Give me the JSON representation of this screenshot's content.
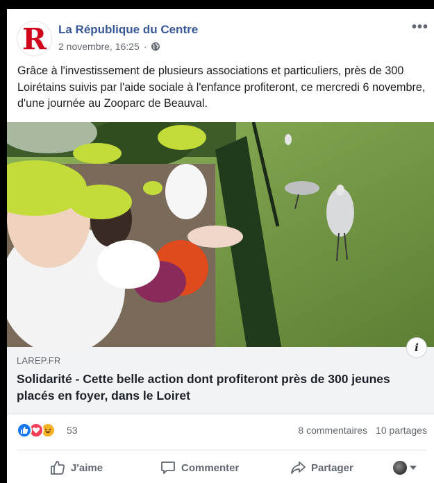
{
  "post": {
    "page_name": "La République du Centre",
    "avatar_letter": "R",
    "date": "2 novembre, 16:25",
    "separator": "·",
    "more": "•••",
    "text": "Grâce à l'investissement de plusieurs associations et particuliers, près de 300 Loirétains suivis par l'aide sociale à l'enfance profiteront, ce mercredi 6 novembre, d'une journée au Zooparc de Beauval."
  },
  "link": {
    "domain": "LAREP.FR",
    "headline": "Solidarité - Cette belle action dont profiteront près de 300 jeunes placés en foyer, dans le Loiret",
    "info": "i"
  },
  "stats": {
    "reaction_count": "53",
    "comments": "8 commentaires",
    "shares": "10 partages"
  },
  "actions": {
    "like": "J'aime",
    "comment": "Commenter",
    "share": "Partager"
  },
  "colors": {
    "page_link": "#385898",
    "brand_red": "#d0021b",
    "like_blue": "#1877f2",
    "love_red": "#f33e58",
    "haha_yellow": "#f7b125"
  }
}
